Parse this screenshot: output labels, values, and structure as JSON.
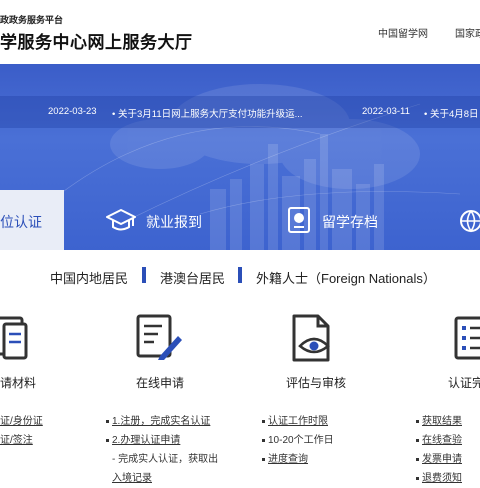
{
  "header": {
    "platform_name": "政政务服务平台",
    "site_title": "学服务中心网上服务大厅",
    "top_links": [
      "中国留学网",
      "国家政"
    ]
  },
  "news": [
    {
      "date": "2022-03-23",
      "text": "• 关于3月11日网上服务大厅支付功能升级运..."
    },
    {
      "date": "2022-03-11",
      "text": "• 关于4月8日"
    }
  ],
  "service_tabs": {
    "active_label": "位认证",
    "job_label": "就业报到",
    "archive_label": "留学存档"
  },
  "categories": [
    "中国内地居民",
    "港澳台居民",
    "外籍人士（Foreign Nationals）"
  ],
  "steps": [
    {
      "title": "请材料",
      "items": [
        "证/身份证",
        "证/签注"
      ]
    },
    {
      "title": "在线申请",
      "items": [
        "1.注册，完成实名认证",
        "2.办理认证申请",
        "- 完成实人认证，获取出",
        "入境记录"
      ]
    },
    {
      "title": "评估与审核",
      "items": [
        "认证工作时限",
        "10-20个工作日",
        "进度查询"
      ]
    },
    {
      "title": "认证完",
      "items": [
        "获取结果",
        "在线查验",
        "发票申请",
        "退费须知"
      ]
    }
  ],
  "colors": {
    "brand_blue": "#2b4fb8",
    "banner_blue": "#4a70d6"
  }
}
